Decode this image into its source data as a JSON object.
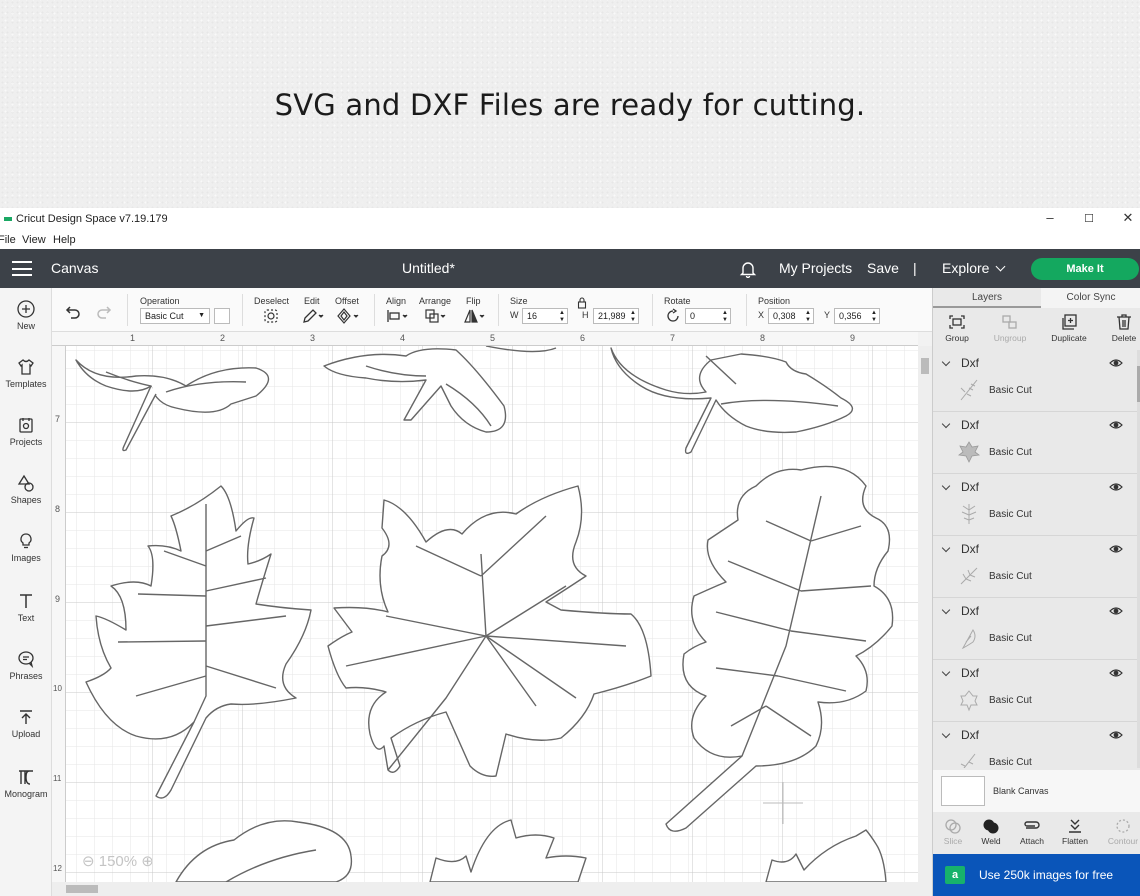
{
  "banner": {
    "text": "SVG and DXF Files are ready for cutting."
  },
  "window": {
    "title": "Cricut Design Space  v7.19.179",
    "controls": {
      "minimize": "–",
      "maximize": "☐",
      "close": "✕"
    },
    "menu": [
      "File",
      "View",
      "Help"
    ]
  },
  "header": {
    "section": "Canvas",
    "doc_title": "Untitled*",
    "my_projects": "My Projects",
    "save": "Save",
    "divider": "|",
    "explore": "Explore",
    "make_it": "Make It"
  },
  "left_tools": [
    "New",
    "Templates",
    "Projects",
    "Shapes",
    "Images",
    "Text",
    "Phrases",
    "Upload",
    "Monogram"
  ],
  "toolbar": {
    "operation_label": "Operation",
    "operation_value": "Basic Cut",
    "deselect": "Deselect",
    "edit": "Edit",
    "offset": "Offset",
    "align": "Align",
    "arrange": "Arrange",
    "flip": "Flip",
    "size_label": "Size",
    "w_label": "W",
    "w_value": "16",
    "h_label": "H",
    "h_value": "21,989",
    "rotate_label": "Rotate",
    "rotate_value": "0",
    "position_label": "Position",
    "x_label": "X",
    "x_value": "0,308",
    "y_label": "Y",
    "y_value": "0,356"
  },
  "rulers": {
    "top": [
      "1",
      "2",
      "3",
      "4",
      "5",
      "6",
      "7",
      "8",
      "9"
    ],
    "left": [
      "7",
      "8",
      "9",
      "10",
      "11",
      "12"
    ]
  },
  "zoom": "150%",
  "right_panel": {
    "tabs": [
      "Layers",
      "Color Sync"
    ],
    "actions": [
      "Group",
      "Ungroup",
      "Duplicate",
      "Delete"
    ],
    "layers": [
      {
        "name": "Dxf",
        "operation": "Basic Cut"
      },
      {
        "name": "Dxf",
        "operation": "Basic Cut"
      },
      {
        "name": "Dxf",
        "operation": "Basic Cut"
      },
      {
        "name": "Dxf",
        "operation": "Basic Cut"
      },
      {
        "name": "Dxf",
        "operation": "Basic Cut"
      },
      {
        "name": "Dxf",
        "operation": "Basic Cut"
      },
      {
        "name": "Dxf",
        "operation": "Basic Cut"
      }
    ],
    "blank_canvas": "Blank Canvas",
    "bottom_actions": [
      "Slice",
      "Weld",
      "Attach",
      "Flatten",
      "Contour"
    ],
    "promo": "Use 250k images for free",
    "promo_icon": "a"
  },
  "colors": {
    "header_bg": "#3c4148",
    "make_it": "#14a85f",
    "promo_bg": "#0a55b9"
  }
}
